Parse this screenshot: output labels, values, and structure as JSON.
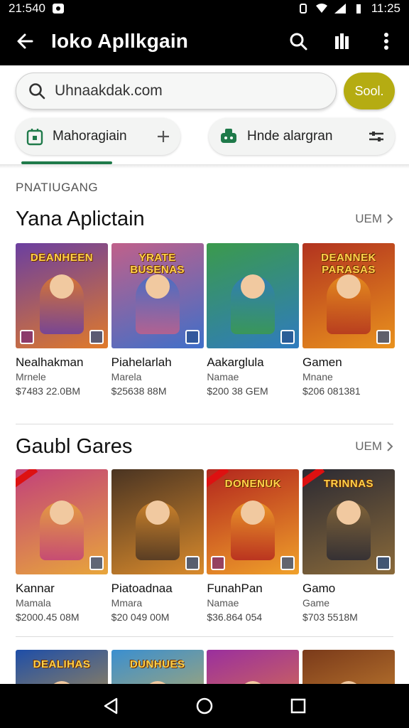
{
  "status_bar": {
    "time_left": "21:540",
    "time_right": "11:25"
  },
  "app_bar": {
    "title": "Ioko Apllkgain"
  },
  "search": {
    "value": "Uhnaakdak.com",
    "button_label": "Sool."
  },
  "chips": [
    {
      "label": "Mahoragiain"
    },
    {
      "label": "Hnde alargran"
    }
  ],
  "section_label": "PNATIUGANG",
  "sections": [
    {
      "title": "Yana Aplictain",
      "more": "UEM",
      "apps": [
        {
          "banner": "DEANHEEN",
          "name": "Nealhakman",
          "sub": "Mrnele",
          "price": "$7483 22.0BM",
          "colors": [
            "#6b3fa0",
            "#e07a2a"
          ]
        },
        {
          "banner": "YRATE BUSENAS",
          "name": "Piahelarlah",
          "sub": "Marela",
          "price": "$25638 88M",
          "colors": [
            "#c0608a",
            "#3f6fc9"
          ]
        },
        {
          "banner": "",
          "name": "Aakarglula",
          "sub": "Namae",
          "price": "$200 38 GEM",
          "colors": [
            "#3b9a4c",
            "#2f7bbf"
          ]
        },
        {
          "banner": "DEANNEK PARASAS",
          "name": "Gamen",
          "sub": "Mnane",
          "price": "$206 081381",
          "colors": [
            "#b2331f",
            "#e9921e"
          ]
        }
      ]
    },
    {
      "title": "Gaubl Gares",
      "more": "UEM",
      "apps": [
        {
          "banner": "",
          "name": "Kannar",
          "sub": "Mamala",
          "price": "$2000.45 08M",
          "colors": [
            "#c2417a",
            "#e8a63b"
          ]
        },
        {
          "banner": "",
          "name": "Piatoadnaa",
          "sub": "Mmara",
          "price": "$20 049 00M",
          "colors": [
            "#4a3422",
            "#d88a2c"
          ]
        },
        {
          "banner": "DONENUK",
          "name": "FunahPan",
          "sub": "Namae",
          "price": "$36.864 054",
          "colors": [
            "#b3261e",
            "#f0a12a"
          ]
        },
        {
          "banner": "TRINNAS",
          "name": "Gamo",
          "sub": "Game",
          "price": "$703 5518M",
          "colors": [
            "#2b2a33",
            "#8a6a3a"
          ]
        }
      ]
    },
    {
      "apps": [
        {
          "banner": "DEALIHAS",
          "colors": [
            "#1e4ea8",
            "#e0a52c"
          ]
        },
        {
          "banner": "DUNHUES",
          "colors": [
            "#3a8fd0",
            "#e7b43a"
          ]
        },
        {
          "banner": "",
          "colors": [
            "#9a2f9e",
            "#f08a2f"
          ]
        },
        {
          "banner": "",
          "colors": [
            "#7a3a1a",
            "#e09a3a"
          ]
        }
      ]
    }
  ]
}
